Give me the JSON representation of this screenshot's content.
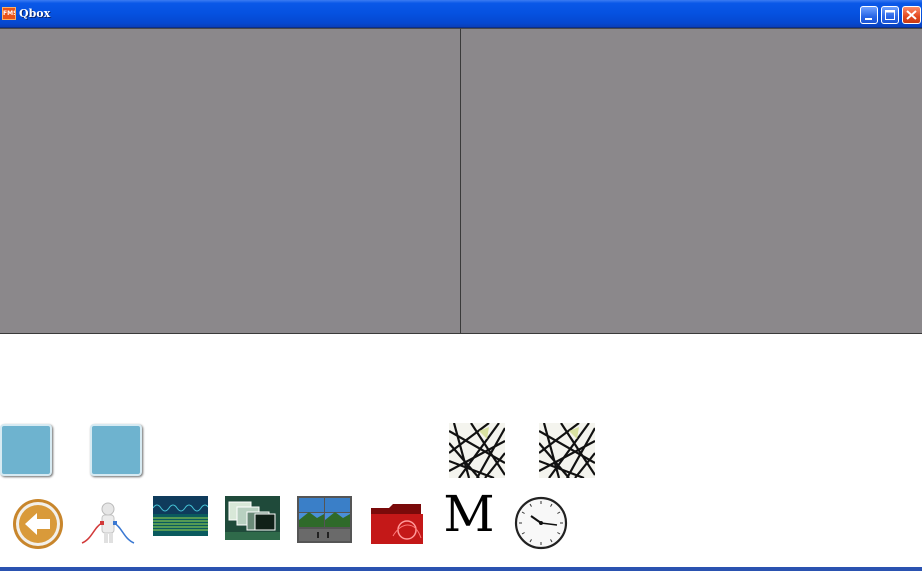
{
  "window": {
    "title": "Qbox",
    "app_icon_text": "FMS",
    "controls": [
      "minimize-icon",
      "maximize-icon",
      "close-icon"
    ]
  },
  "panels": [
    "left-video-panel",
    "right-video-panel"
  ],
  "toolbar_top": [
    "square-button-1",
    "square-button-2",
    "mesh-icon-1",
    "mesh-icon-2"
  ],
  "toolbar_bottom": [
    "back-arrow-icon",
    "network-cable-icon",
    "waveform-icon",
    "stacked-windows-icon",
    "video-wall-icon",
    "red-folder-icon",
    "m-letter-icon",
    "clock-icon"
  ],
  "m_letter": "M",
  "clock": {
    "hour": 3,
    "minute": 20
  },
  "colors": {
    "titlebar": "#0551e0",
    "panel": "#8b888b",
    "square": "#6eb3cf",
    "bottom_bar": "#2a52b0"
  }
}
